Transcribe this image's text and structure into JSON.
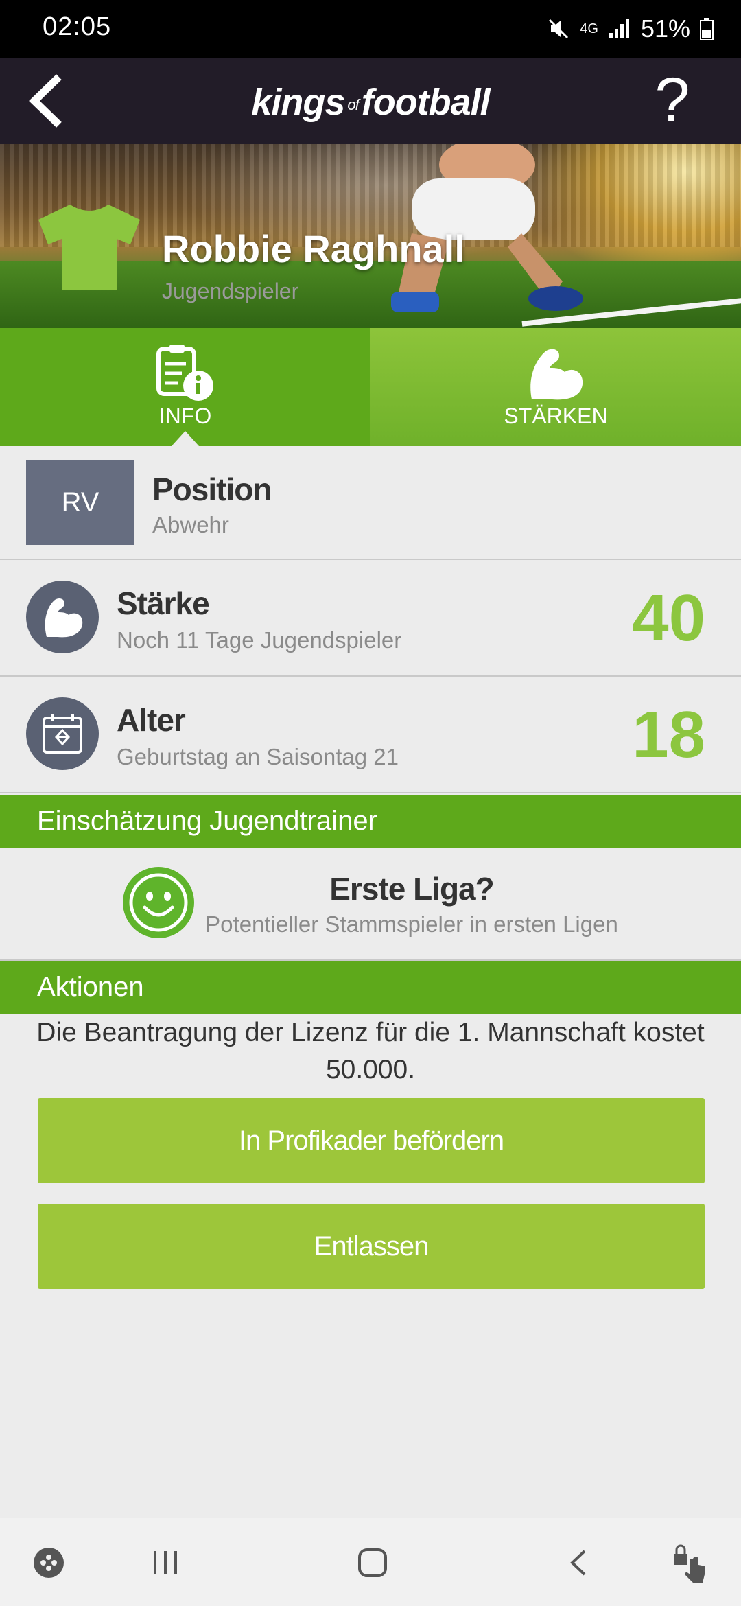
{
  "status_bar": {
    "time": "02:05",
    "network": "4G",
    "battery": "51%"
  },
  "app_bar": {
    "logo_main_1": "kings",
    "logo_of": "of",
    "logo_main_2": "football",
    "help": "?"
  },
  "player": {
    "name": "Robbie Raghnall",
    "status": "Jugendspieler"
  },
  "tabs": [
    {
      "label": "INFO",
      "icon": "info-document-icon",
      "active": true
    },
    {
      "label": "STÄRKEN",
      "icon": "muscle-arm-icon",
      "active": false
    }
  ],
  "position": {
    "badge": "RV",
    "title": "Position",
    "value": "Abwehr"
  },
  "staerke": {
    "title": "Stärke",
    "sub": "Noch 11 Tage Jugendspieler",
    "value": "40"
  },
  "alter": {
    "title": "Alter",
    "sub": "Geburtstag an Saisontag 21",
    "value": "18"
  },
  "trainer_section": {
    "header": "Einschätzung Jugendtrainer",
    "title": "Erste Liga?",
    "sub": "Potentieller Stammspieler in ersten Ligen"
  },
  "aktionen_section": {
    "header": "Aktionen",
    "license_text": "Die Beantragung der Lizenz für die 1. Mannschaft kostet 50.000.",
    "promote_label": "In Profikader befördern",
    "dismiss_label": "Entlassen"
  },
  "colors": {
    "green_dark": "#5ea91b",
    "green_light": "#9dc63a",
    "value_green": "#8cc63f",
    "header_bg": "#221c28"
  }
}
